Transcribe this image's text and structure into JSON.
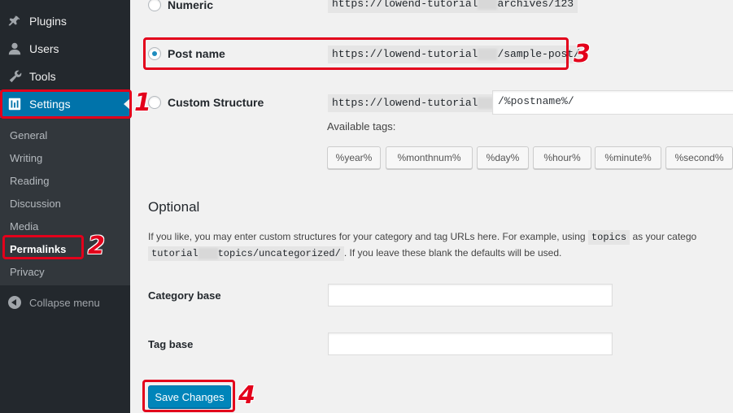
{
  "sidebar": {
    "top_items": [
      {
        "label": "Plugins",
        "icon": "plugin-icon"
      },
      {
        "label": "Users",
        "icon": "user-icon"
      },
      {
        "label": "Tools",
        "icon": "wrench-icon"
      },
      {
        "label": "Settings",
        "icon": "settings-icon"
      }
    ],
    "submenu": [
      "General",
      "Writing",
      "Reading",
      "Discussion",
      "Media",
      "Permalinks",
      "Privacy"
    ],
    "collapse_label": "Collapse menu"
  },
  "permalinks": {
    "numeric": {
      "label": "Numeric",
      "example_prefix": "https://lowend-tutorial",
      "example_suffix": "archives/123"
    },
    "post_name": {
      "label": "Post name",
      "example_prefix": "https://lowend-tutorial",
      "example_suffix": "/sample-post/"
    },
    "custom": {
      "label": "Custom Structure",
      "prefix": "https://lowend-tutorial",
      "value": "/%postname%/"
    },
    "available_tags_label": "Available tags:",
    "tags": [
      "%year%",
      "%monthnum%",
      "%day%",
      "%hour%",
      "%minute%",
      "%second%"
    ]
  },
  "optional": {
    "title": "Optional",
    "desc_part1": "If you like, you may enter custom structures for your category and tag URLs here. For example, using",
    "desc_code1": "topics",
    "desc_part2": "as your catego",
    "desc_code2_prefix": "tutorial",
    "desc_code2_suffix": "topics/uncategorized/",
    "desc_part3": ". If you leave these blank the defaults will be used.",
    "category_base_label": "Category base",
    "category_base_value": "",
    "tag_base_label": "Tag base",
    "tag_base_value": ""
  },
  "save_label": "Save Changes",
  "annotations": [
    "1",
    "2",
    "3",
    "4"
  ],
  "colors": {
    "accent": "#0073aa",
    "highlight": "#e3001b",
    "sidebar": "#23282d"
  }
}
